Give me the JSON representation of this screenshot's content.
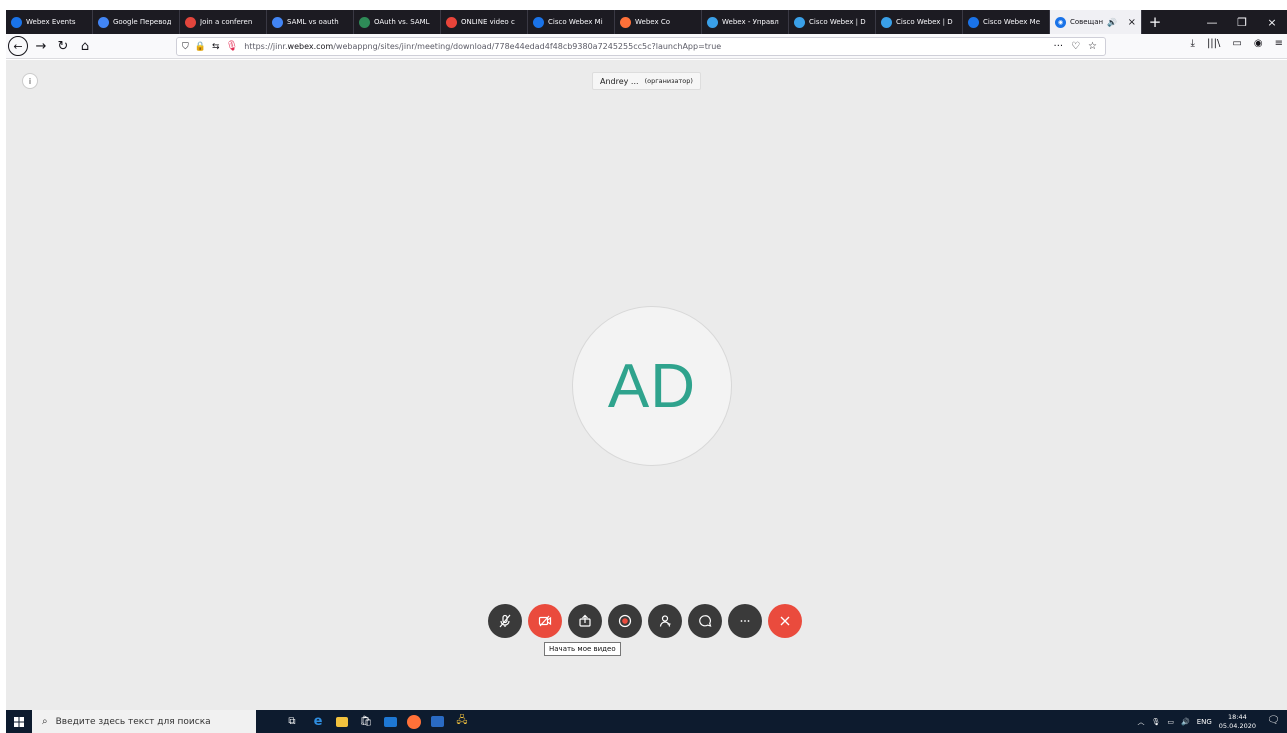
{
  "browser": {
    "tabs": [
      {
        "label": "Webex Events",
        "icon": "webex-icon",
        "color": "#1a73e8"
      },
      {
        "label": "Google Перевод",
        "icon": "google-translate-icon",
        "color": "#4285f4"
      },
      {
        "label": "Join a conferen",
        "icon": "grid-icon",
        "color": "#e2453c"
      },
      {
        "label": "SAML vs oauth",
        "icon": "google-icon",
        "color": "#4285f4"
      },
      {
        "label": "OAuth vs. SAML",
        "icon": "shield-icon",
        "color": "#2e8b57"
      },
      {
        "label": "ONLINE video c",
        "icon": "record-icon",
        "color": "#e8443a"
      },
      {
        "label": "Cisco Webex Mi",
        "icon": "webex-icon",
        "color": "#1a73e8"
      },
      {
        "label": "Webex Co",
        "icon": "firefox-icon",
        "color": "#ff7139"
      },
      {
        "label": "Webex - Управл",
        "icon": "grid-icon",
        "color": "#3aa0e8"
      },
      {
        "label": "Cisco Webex | D",
        "icon": "grid-icon",
        "color": "#3aa0e8"
      },
      {
        "label": "Cisco Webex | D",
        "icon": "grid-icon",
        "color": "#3aa0e8"
      },
      {
        "label": "Cisco Webex Me",
        "icon": "webex-icon",
        "color": "#1a73e8"
      }
    ],
    "active_tab": {
      "label": "Совещан",
      "icon": "webex-icon",
      "sound": "🔊",
      "close": "×"
    },
    "new_tab": "+",
    "window_controls": {
      "minimize": "—",
      "maximize": "❐",
      "close": "×"
    },
    "url": {
      "prefix": "https://jinr.",
      "domain": "webex.com",
      "path": "/webappng/sites/jinr/meeting/download/778e44edad4f48cb9380a7245255cc5c?launchApp=true"
    },
    "url_actions": {
      "more": "···",
      "pocket": "♡",
      "bookmark": "☆"
    },
    "toolbar_right": {
      "download": "⤓",
      "library": "|||\\",
      "sidebar": "▭",
      "account": "◉",
      "menu": "≡"
    }
  },
  "meeting": {
    "info_glyph": "i",
    "participant_name": "Andrey ...",
    "participant_role": "(организатор)",
    "avatar_initials": "AD",
    "accent_color": "#2fa38d",
    "controls": [
      {
        "name": "mute-button",
        "icon": "mic-off-icon",
        "red": false
      },
      {
        "name": "video-button",
        "icon": "video-off-icon",
        "red": true
      },
      {
        "name": "share-button",
        "icon": "share-icon",
        "red": false
      },
      {
        "name": "record-button",
        "icon": "record-icon",
        "red": false
      },
      {
        "name": "participants-button",
        "icon": "participants-icon",
        "red": false
      },
      {
        "name": "chat-button",
        "icon": "chat-icon",
        "red": false
      },
      {
        "name": "more-button",
        "icon": "more-icon",
        "red": false
      },
      {
        "name": "leave-button",
        "icon": "close-icon",
        "red": true
      }
    ],
    "tooltip": "Начать мое видео"
  },
  "taskbar": {
    "search_placeholder": "Введите здесь текст для поиска",
    "apps": [
      "task-view-icon",
      "edge-icon",
      "file-explorer-icon",
      "store-icon",
      "mail-icon",
      "firefox-icon",
      "screen-icon",
      "network-drive-icon"
    ],
    "language": "ENG",
    "time": "18:44",
    "date": "05.04.2020"
  }
}
